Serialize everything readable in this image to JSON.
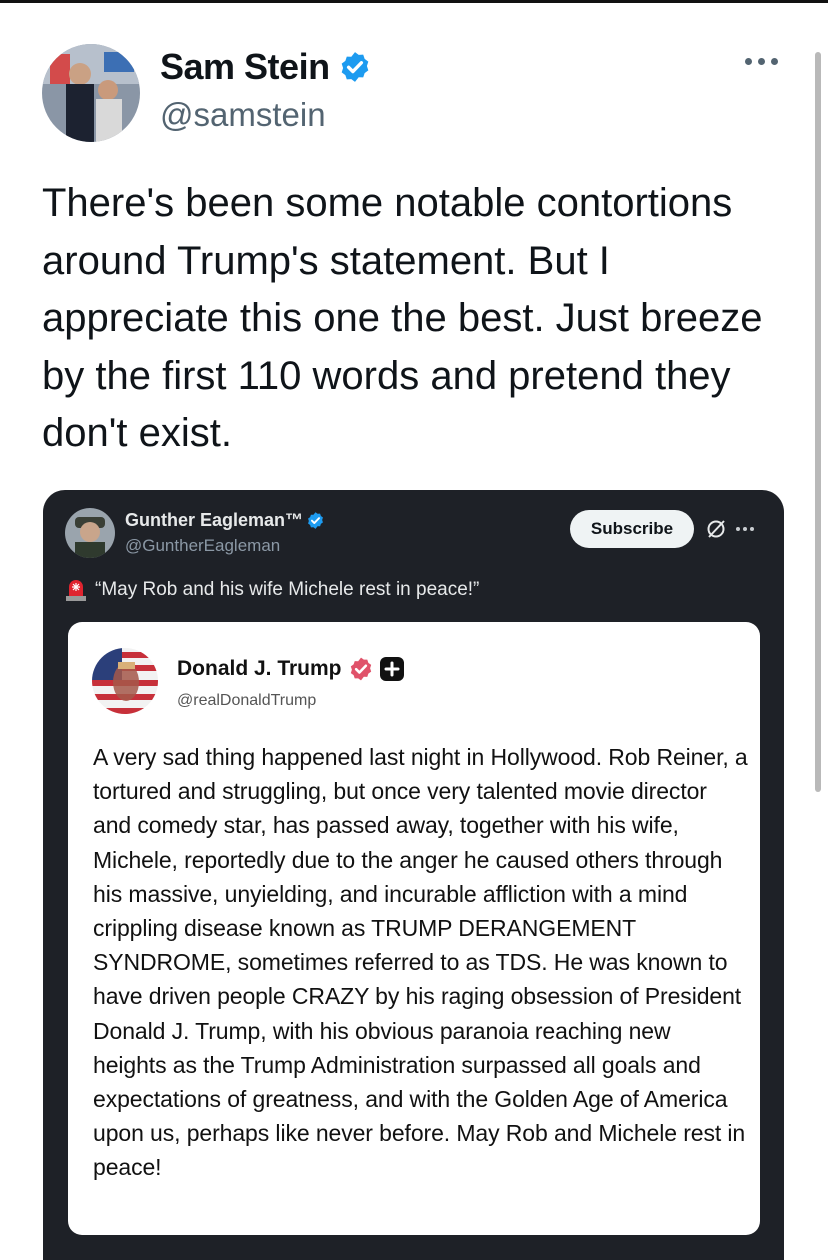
{
  "tweet": {
    "author_name": "Sam Stein",
    "handle": "@samstein",
    "text": "There's been some notable contortions around Trump's statement. But I appreciate this one the best. Just breeze by the first 110 words and pretend they don't exist."
  },
  "quote": {
    "author_name": "Gunther Eagleman™",
    "handle": "@GuntherEagleman",
    "subscribe_label": "Subscribe",
    "text": "“May Rob and his wife Michele rest in peace!”",
    "embedded": {
      "author_name": "Donald J. Trump",
      "handle": "@realDonaldTrump",
      "text": "A very sad thing happened last night in Hollywood. Rob Reiner, a tortured and struggling, but once very talented movie director and comedy star, has passed away, together with his wife, Michele, reportedly due to the anger he caused others through his massive, unyielding, and incurable affliction with a mind crippling disease known as TRUMP DERANGEMENT SYNDROME, sometimes referred to as TDS. He was known to have driven people CRAZY by his raging obsession of President Donald J. Trump, with his obvious paranoia reaching new heights as the Trump Administration surpassed all goals and expectations of greatness, and with the Golden Age of America upon us, perhaps like never before. May Rob and Michele rest in peace!"
    }
  },
  "colors": {
    "verified_blue": "#1d9bf0",
    "quote_background": "#1e2127",
    "truth_badge": "#e0526a"
  },
  "icons": [
    "verified-badge-icon",
    "more-options-icon",
    "grok-icon",
    "siren-emoji-icon",
    "truth-verified-icon",
    "plus-icon"
  ]
}
